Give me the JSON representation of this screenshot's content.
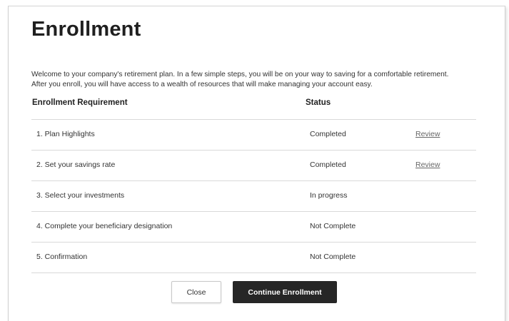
{
  "page": {
    "title": "Enrollment",
    "intro_line1": "Welcome to your company's retirement plan. In a few simple steps, you will be on your way to saving for a comfortable retirement.",
    "intro_line2": "After you enroll, you will have access to a wealth of resources that will make managing your account easy."
  },
  "table": {
    "headers": {
      "requirement": "Enrollment Requirement",
      "status": "Status"
    },
    "rows": [
      {
        "requirement": "1. Plan Highlights",
        "status": "Completed",
        "action": "Review"
      },
      {
        "requirement": "2. Set your savings rate",
        "status": "Completed",
        "action": "Review"
      },
      {
        "requirement": "3. Select your investments",
        "status": "In progress",
        "action": ""
      },
      {
        "requirement": "4. Complete your beneficiary designation",
        "status": "Not Complete",
        "action": ""
      },
      {
        "requirement": "5. Confirmation",
        "status": "Not Complete",
        "action": ""
      }
    ]
  },
  "buttons": {
    "close_label": "Close",
    "continue_label": "Continue Enrollment"
  },
  "colors": {
    "primary_button": "#262626",
    "divider": "#d9d9d9",
    "link": "#666666"
  }
}
